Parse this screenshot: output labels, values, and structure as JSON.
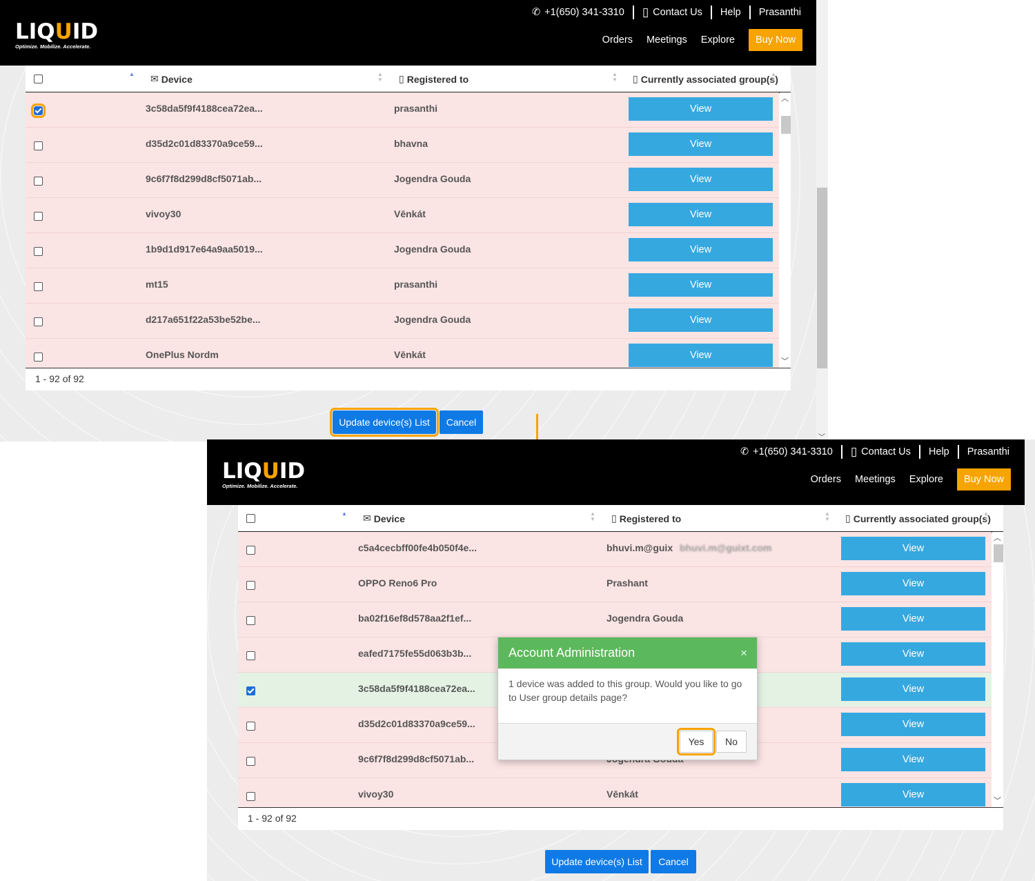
{
  "header": {
    "logo_text_pre": "LIQ",
    "logo_text_u": "U",
    "logo_text_post": "ID",
    "logo_tagline": "Optimize. Mobilize. Accelerate.",
    "phone": "+1(650) 341-3310",
    "contact": "Contact Us",
    "help": "Help",
    "user": "Prasanthi",
    "nav": [
      "Orders",
      "Meetings",
      "Explore"
    ],
    "buy_now": "Buy Now"
  },
  "table": {
    "col_device": "Device",
    "col_registered": "Registered to",
    "col_groups": "Currently associated group(s)",
    "view_label": "View",
    "pager": "1 - 92 of 92"
  },
  "top_rows": [
    {
      "device": "3c58da5f9f4188cea72ea...",
      "registered": "prasanthi",
      "checked": true
    },
    {
      "device": "d35d2c01d83370a9ce59...",
      "registered": "bhavna",
      "checked": false
    },
    {
      "device": "9c6f7f8d299d8cf5071ab...",
      "registered": "Jogendra Gouda",
      "checked": false
    },
    {
      "device": "vivoy30",
      "registered": "Vēnkát",
      "checked": false
    },
    {
      "device": "1b9d1d917e64a9aa5019...",
      "registered": "Jogendra Gouda",
      "checked": false
    },
    {
      "device": "mt15",
      "registered": "prasanthi",
      "checked": false
    },
    {
      "device": "d217a651f22a53be52be...",
      "registered": "Jogendra Gouda",
      "checked": false
    },
    {
      "device": "OnePlus Nordm",
      "registered": "Vēnkát",
      "checked": false
    }
  ],
  "bottom_rows": [
    {
      "device": "c5a4cecbff00fe4b050f4e...",
      "registered": "bhuvi.m@guix",
      "checked": false
    },
    {
      "device": "OPPO Reno6 Pro",
      "registered": "Prashant",
      "checked": false
    },
    {
      "device": "ba02f16ef8d578aa2f1ef...",
      "registered": "Jogendra Gouda",
      "checked": false
    },
    {
      "device": "eafed7175fe55d063b3b...",
      "registered": "",
      "checked": false
    },
    {
      "device": "3c58da5f9f4188cea72ea...",
      "registered": "",
      "checked": true
    },
    {
      "device": "d35d2c01d83370a9ce59...",
      "registered": "",
      "checked": false
    },
    {
      "device": "9c6f7f8d299d8cf5071ab...",
      "registered": "Jogendra Gouda",
      "checked": false
    },
    {
      "device": "vivoy30",
      "registered": "Vēnkát",
      "checked": false
    }
  ],
  "actions": {
    "update": "Update device(s) List",
    "cancel": "Cancel"
  },
  "modal": {
    "title": "Account Administration",
    "close": "×",
    "message": "1 device was added to this group. Would you like to go to User group details page?",
    "yes": "Yes",
    "no": "No"
  },
  "colors": {
    "accent": "#f7a300",
    "view_button": "#36a8e0",
    "primary_button": "#0f7ae5",
    "modal_header": "#5cb85c",
    "row_bg": "#fbe4e4",
    "selected_row_bg": "#e4f2e4"
  }
}
